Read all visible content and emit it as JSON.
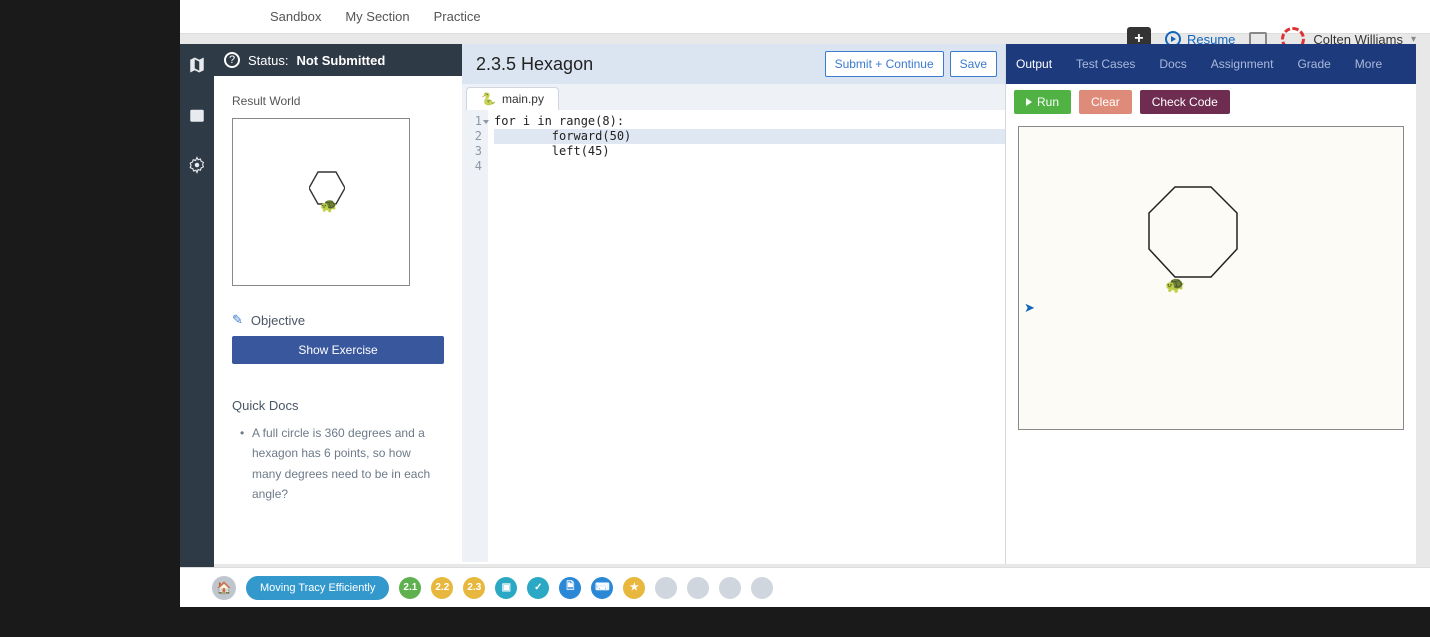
{
  "top_nav": {
    "sandbox": "Sandbox",
    "my_section": "My Section",
    "practice": "Practice"
  },
  "toolbar": {
    "resume": "Resume",
    "user": "Colten Williams"
  },
  "status": {
    "label": "Status:",
    "value": "Not Submitted"
  },
  "sidebar": {
    "result_title": "Result World",
    "objective": "Objective",
    "show_exercise": "Show Exercise",
    "quick_docs_title": "Quick Docs",
    "quick_docs_body": "A full circle is 360 degrees and a hexagon has 6 points, so how many degrees need to be in each angle?"
  },
  "editor": {
    "title": "2.3.5 Hexagon",
    "submit": "Submit + Continue",
    "save": "Save",
    "file": "main.py",
    "lines": [
      "",
      "for i in range(8):",
      "        forward(50)",
      "        left(45)"
    ]
  },
  "output": {
    "tabs": [
      "Output",
      "Test Cases",
      "Docs",
      "Assignment",
      "Grade",
      "More"
    ],
    "run": "Run",
    "clear": "Clear",
    "check": "Check Code"
  },
  "bottom": {
    "lesson": "Moving Tracy Efficiently",
    "badges": [
      "2.1",
      "2.2",
      "2.3"
    ]
  }
}
